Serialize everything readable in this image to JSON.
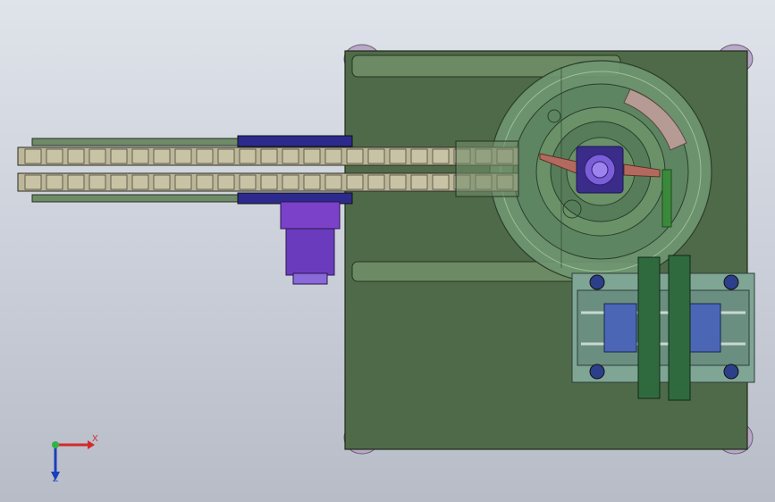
{
  "window": {
    "type": "cad-graphics-area",
    "background": "#cfd3dc"
  },
  "model": {
    "parts": [
      {
        "name": "base-plate",
        "color": "#4f6a48"
      },
      {
        "name": "conveyor-track",
        "color": "#bdb79a"
      },
      {
        "name": "conveyor-side-rail",
        "color": "#5f7a55"
      },
      {
        "name": "drive-motor",
        "color": "#7b42c9"
      },
      {
        "name": "motor-mount",
        "color": "#2c2a8c"
      },
      {
        "name": "vibratory-bowl",
        "color": "#5d8a62"
      },
      {
        "name": "bowl-drive-hub",
        "color": "#6c4ec7"
      },
      {
        "name": "sweep-arm",
        "color": "#b36a5e"
      },
      {
        "name": "linear-guide-block",
        "color": "#7fa595"
      },
      {
        "name": "slide-carriage",
        "color": "#4b66b5"
      },
      {
        "name": "outlet-rail",
        "color": "#2f6a3e"
      },
      {
        "name": "leveling-foot",
        "color": "#b9a8c7"
      }
    ]
  },
  "axes": {
    "x_label": "X",
    "z_label": "Z",
    "x_color": "#d42a2a",
    "y_color": "#2fb34a",
    "z_color": "#1b3dbf"
  }
}
